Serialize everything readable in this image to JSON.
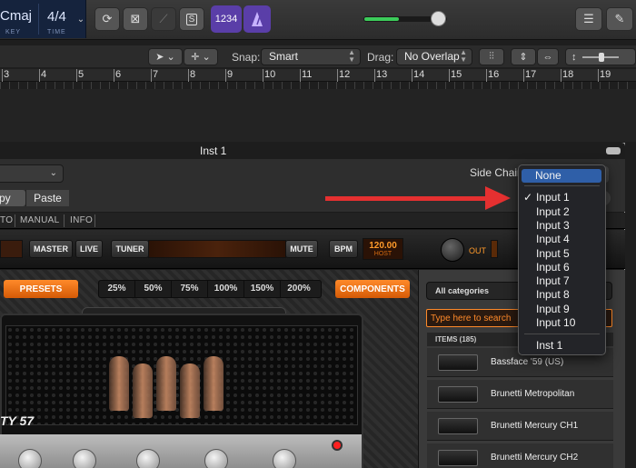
{
  "lcd": {
    "key_value": "Cmaj",
    "key_label": "KEY",
    "time_value": "4/4",
    "time_label": "TIME"
  },
  "topbar": {
    "count_in_label": "1234",
    "capture_label": "S"
  },
  "toolbar2": {
    "snap_label": "Snap:",
    "snap_value": "Smart",
    "drag_label": "Drag:",
    "drag_value": "No Overlap"
  },
  "ruler": {
    "numbers": [
      "3",
      "4",
      "5",
      "6",
      "7",
      "8",
      "9",
      "10",
      "11",
      "12",
      "13",
      "14",
      "15",
      "16",
      "17",
      "18",
      "19"
    ]
  },
  "plugin": {
    "title": "Inst 1",
    "copy_label": "py",
    "paste_label": "Paste",
    "side_chain_label": "Side Chain",
    "tabs": [
      "TO",
      "MANUAL",
      "INFO"
    ],
    "strip": {
      "master": "MASTER",
      "live": "LIVE",
      "tuner": "TUNER",
      "mute": "MUTE",
      "bpm": "BPM",
      "bpm_value": "120.00",
      "bpm_source": "HOST",
      "out": "OUT"
    },
    "presets_label": "PRESETS",
    "components_label": "COMPONENTS",
    "zoom_levels": [
      "25%",
      "50%",
      "75%",
      "100%",
      "150%",
      "200%"
    ],
    "amp_logo": "TY 57",
    "browser": {
      "category": "All categories",
      "search_placeholder": "Type here to search",
      "items_header": "ITEMS (185)",
      "items": [
        "Bassface '59 (US)",
        "Brunetti Metropolitan",
        "Brunetti Mercury CH1",
        "Brunetti Mercury CH2"
      ]
    }
  },
  "side_chain_menu": {
    "items": [
      "None",
      "Input 1",
      "Input 2",
      "Input 3",
      "Input 4",
      "Input 5",
      "Input 6",
      "Input 7",
      "Input 8",
      "Input 9",
      "Input 10",
      "Inst 1"
    ],
    "highlighted": "None",
    "checked": "Input 1"
  },
  "colors": {
    "accent_purple": "#5a3ea8",
    "orange": "#ff8a2a",
    "menu_highlight": "#2f5fa8",
    "arrow_red": "#e53030",
    "level_green": "#3ccc5a"
  }
}
